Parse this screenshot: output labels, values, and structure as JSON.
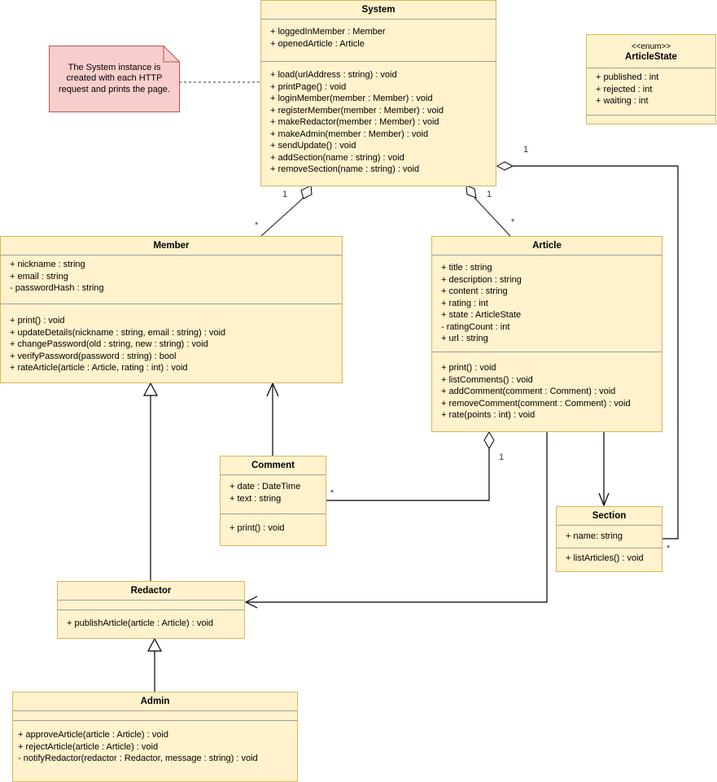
{
  "diagram": {
    "type": "UML class diagram",
    "colors": {
      "class_fill": "#fff2cc",
      "class_border": "#d6b656",
      "note_fill": "#f8cecc",
      "note_border": "#b85450",
      "line": "#000000"
    },
    "note": {
      "text": "The System instance is created with each HTTP request and prints the page."
    },
    "classes": {
      "system": {
        "name": "System",
        "attributes": [
          "+ loggedInMember : Member",
          "+ openedArticle : Article"
        ],
        "methods": [
          "+ load(urlAddress : string) : void",
          "+ printPage() : void",
          "+ loginMember(member : Member) : void",
          "+ registerMember(member : Member) : void",
          "+ makeRedactor(member : Member) : void",
          "+ makeAdmin(member : Member) : void",
          "+ sendUpdate() : void",
          "+ addSection(name : string) : void",
          "+ removeSection(name : string) : void"
        ]
      },
      "article_state": {
        "stereotype": "<<enum>>",
        "name": "ArticleState",
        "attributes": [
          "+ published : int",
          "+ rejected : int",
          "+ waiting : int"
        ],
        "methods": []
      },
      "member": {
        "name": "Member",
        "attributes": [
          "+ nickname : string",
          "+ email : string",
          "- passwordHash : string"
        ],
        "methods": [
          "+ print() : void",
          "+ updateDetails(nickname : string, email : string) : void",
          "+ changePassword(old : string, new : string) : void",
          "+ verifyPassword(password : string) : bool",
          "+ rateArticle(article : Article, rating : int) : void"
        ]
      },
      "article": {
        "name": "Article",
        "attributes": [
          "+ title : string",
          "+ description : string",
          "+ content : string",
          "+ rating : int",
          "+ state : ArticleState",
          "- ratingCount : int",
          "+ url : string"
        ],
        "methods": [
          "+ print() : void",
          "+ listComments() : void",
          "+ addComment(comment : Comment) : void",
          "+ removeComment(comment : Comment) : void",
          "+ rate(points : int) : void"
        ]
      },
      "comment": {
        "name": "Comment",
        "attributes": [
          "+ date : DateTime",
          "+ text : string"
        ],
        "methods": [
          "+ print() : void"
        ]
      },
      "section": {
        "name": "Section",
        "attributes": [
          "+ name: string"
        ],
        "methods": [
          "+ listArticles() : void"
        ]
      },
      "redactor": {
        "name": "Redactor",
        "attributes": [],
        "methods": [
          "+ publishArticle(article : Article) : void"
        ]
      },
      "admin": {
        "name": "Admin",
        "attributes": [],
        "methods": [
          "+ approveArticle(article : Article) : void",
          "+ rejectArticle(article : Article) : void",
          "- notifyRedactor(redactor : Redactor, message : string) : void"
        ]
      }
    },
    "relations": [
      {
        "from": "System",
        "to": "Member",
        "kind": "aggregation",
        "source_mult": "1",
        "target_mult": "*"
      },
      {
        "from": "System",
        "to": "Article",
        "kind": "aggregation",
        "source_mult": "1",
        "target_mult": "*"
      },
      {
        "from": "System",
        "to": "Section",
        "kind": "aggregation",
        "source_mult": "1",
        "target_mult": "*"
      },
      {
        "from": "Article",
        "to": "Comment",
        "kind": "aggregation",
        "source_mult": "1",
        "target_mult": "*"
      },
      {
        "from": "Comment",
        "to": "Member",
        "kind": "association"
      },
      {
        "from": "Redactor",
        "to": "Member",
        "kind": "generalization"
      },
      {
        "from": "Admin",
        "to": "Redactor",
        "kind": "generalization"
      },
      {
        "from": "Article",
        "to": "Section",
        "kind": "association"
      },
      {
        "from": "Article",
        "to": "Redactor",
        "kind": "association"
      }
    ],
    "labels": {
      "one": "1",
      "many": "*"
    }
  }
}
